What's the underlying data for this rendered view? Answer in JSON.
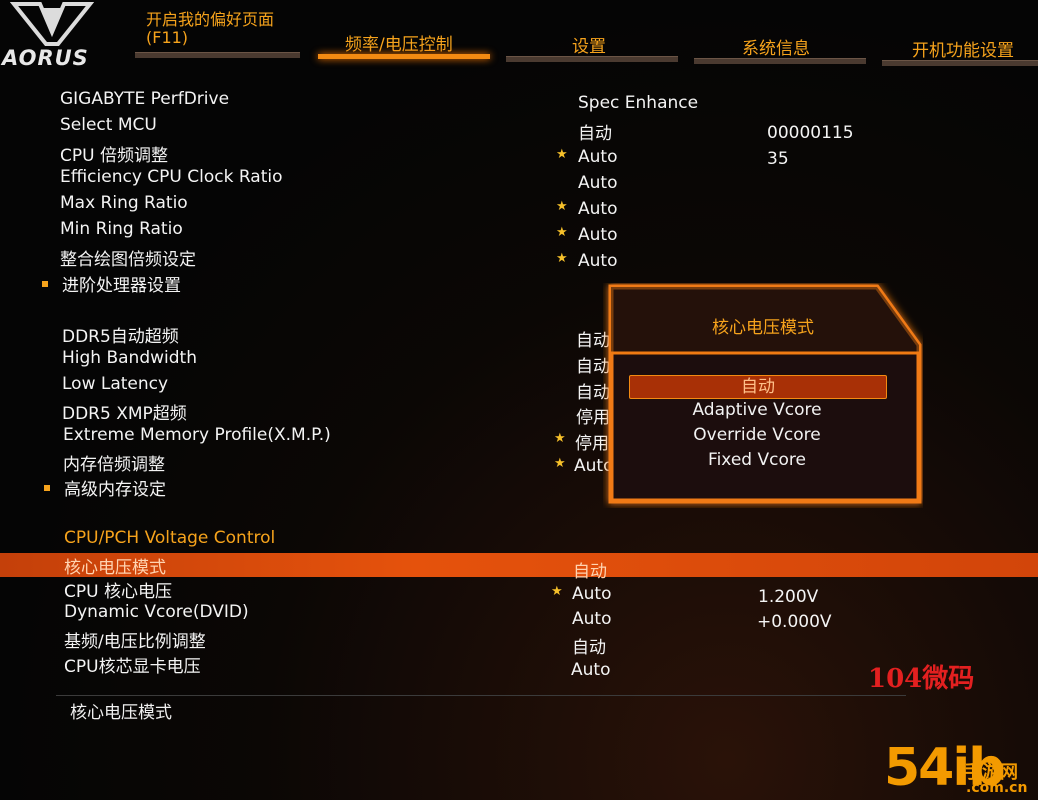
{
  "brand": "AORUS",
  "header": {
    "tabs": [
      {
        "line1": "开启我的偏好页面",
        "line2": "(F11)"
      },
      {
        "label": "频率/电压控制",
        "active": true
      },
      {
        "label": "设置"
      },
      {
        "label": "系统信息"
      },
      {
        "label": "开机功能设置"
      }
    ]
  },
  "rows": [
    {
      "label": "GIGABYTE PerfDrive",
      "value": "Spec Enhance"
    },
    {
      "label": "Select MCU",
      "value": "自动",
      "value2": "00000115"
    },
    {
      "label": "CPU 倍频调整",
      "value": "Auto",
      "value2": "35",
      "star": true
    },
    {
      "label": "Efficiency CPU Clock Ratio",
      "value": "Auto"
    },
    {
      "label": "Max Ring Ratio",
      "value": "Auto",
      "star": true
    },
    {
      "label": "Min Ring Ratio",
      "value": "Auto",
      "star": true
    },
    {
      "label": "整合绘图倍频设定",
      "value": "Auto",
      "star": true
    },
    {
      "label": "进阶处理器设置",
      "bullet": true
    },
    {
      "label": "DDR5自动超频",
      "value": "自动"
    },
    {
      "label": "High Bandwidth",
      "value": "自动"
    },
    {
      "label": "Low Latency",
      "value": "自动"
    },
    {
      "label": "DDR5 XMP超频",
      "value": "停用"
    },
    {
      "label": "Extreme Memory Profile(X.M.P.)",
      "value": "停用",
      "star": true
    },
    {
      "label": "内存倍频调整",
      "value": "Auto",
      "star": true
    },
    {
      "label": "高级内存设定",
      "bullet": true
    },
    {
      "label": "核心电压模式",
      "value": "自动",
      "highlight": true
    },
    {
      "label": "CPU 核心电压",
      "value": "Auto",
      "value2": "1.200V",
      "star": true
    },
    {
      "label": "Dynamic Vcore(DVID)",
      "value": "Auto",
      "value2": "+0.000V"
    },
    {
      "label": "基频/电压比例调整",
      "value": "自动"
    },
    {
      "label": "CPU核芯显卡电压",
      "value": "Auto"
    }
  ],
  "section_title": "CPU/PCH Voltage Control",
  "help_text": "核心电压模式",
  "popup": {
    "title": "核心电压模式",
    "options": [
      {
        "label": "自动",
        "selected": true
      },
      {
        "label": "Adaptive Vcore"
      },
      {
        "label": "Override Vcore"
      },
      {
        "label": "Fixed Vcore"
      }
    ]
  },
  "watermarks": {
    "mark1": "104微码",
    "mark2_big": "54ib",
    "mark2_small": "手游网",
    "mark2_url": ".com.cn"
  },
  "colors": {
    "accent": "#f6a31c",
    "highlight": "#e5520c",
    "star": "#f6c02a"
  }
}
